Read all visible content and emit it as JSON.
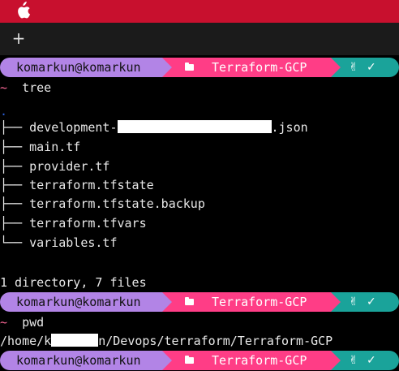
{
  "menubar": {
    "icon": "apple-icon",
    "color": "#c8102e"
  },
  "tabbar": {
    "new_tab_icon": "plus-icon",
    "new_tab_symbol": "+"
  },
  "prompt": {
    "user": "komarkun@komarkun",
    "directory": "Terraform-GCP",
    "folder_icon": "folder-icon",
    "status_icons": [
      "hand-icon",
      "check-icon"
    ],
    "hand_symbol": "✌",
    "check_symbol": "✓",
    "colors": {
      "user": "#b284e6",
      "directory": "#ff3d86",
      "status": "#1aa39a"
    }
  },
  "session": {
    "cmd1": {
      "tilde": "~",
      "command": "tree"
    },
    "tree_root": ".",
    "tree": [
      {
        "branch": "├── ",
        "name_start": "development-",
        "name_end": ".json"
      },
      {
        "branch": "├── ",
        "name": "main.tf"
      },
      {
        "branch": "├── ",
        "name": "provider.tf"
      },
      {
        "branch": "├── ",
        "name": "terraform.tfstate"
      },
      {
        "branch": "├── ",
        "name": "terraform.tfstate.backup"
      },
      {
        "branch": "├── ",
        "name": "terraform.tfvars"
      },
      {
        "branch": "└── ",
        "name": "variables.tf"
      }
    ],
    "summary": "1 directory, 7 files",
    "cmd2": {
      "tilde": "~",
      "command": "pwd"
    },
    "pwd": {
      "start": "/home/k",
      "end": "n/Devops/terraform/Terraform-GCP"
    }
  }
}
